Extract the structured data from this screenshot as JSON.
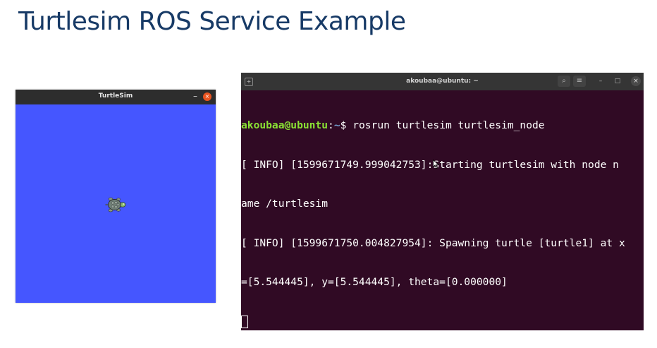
{
  "slide": {
    "title": "Turtlesim ROS Service Example"
  },
  "turtlesim": {
    "window_title": "TurtleSim",
    "minimize_icon": "–",
    "close_icon": "×",
    "background_color": "#4556ff"
  },
  "terminal": {
    "window_title": "akoubaa@ubuntu: ~",
    "new_tab_icon": "+",
    "search_icon": "⌕",
    "menu_icon": "≡",
    "minimize_icon": "–",
    "maximize_icon": "□",
    "close_icon": "×",
    "prompt_user": "akoubaa@ubuntu",
    "prompt_sep": ":",
    "prompt_path": "~",
    "prompt_symbol": "$ ",
    "command": "rosrun turtlesim turtlesim_node",
    "lines": [
      "[ INFO] [1599671749.999042753]:",
      "Starting turtlesim with node n",
      "ame /turtlesim",
      "[ INFO] [1599671750.004827954]: Spawning turtle [turtle1] at x",
      "=[5.544445], y=[5.544445], theta=[0.000000]"
    ],
    "background_color": "#300a24"
  }
}
